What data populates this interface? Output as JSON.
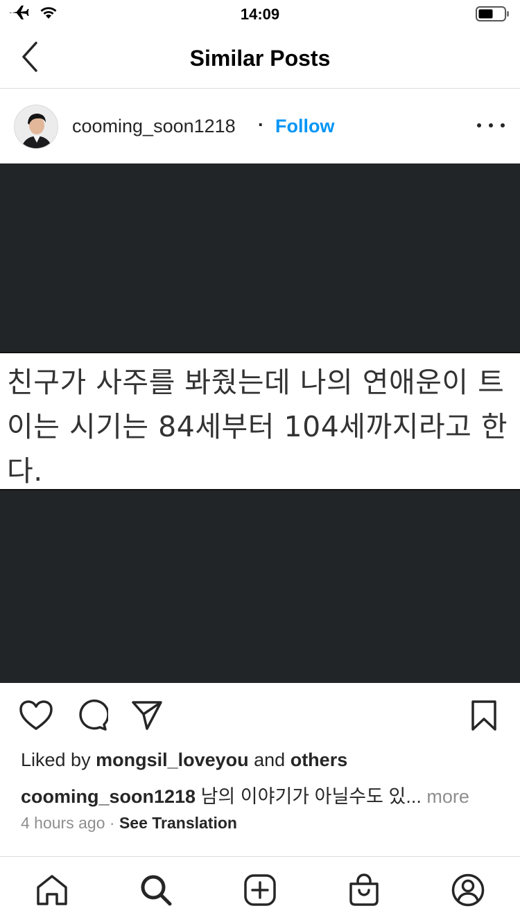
{
  "status_bar": {
    "time": "14:09",
    "icons": [
      "airplane-icon",
      "wifi-icon",
      "battery-icon"
    ]
  },
  "nav": {
    "back_icon": "chevron-left-icon",
    "title": "Similar Posts"
  },
  "post": {
    "username": "cooming_soon1218",
    "separator": "·",
    "follow_label": "Follow",
    "more_icon": "more-horizontal-icon",
    "image_text": "친구가 사주를 봐줬는데 나의 연애운이 트\n이는 시기는 84세부터 104세까지라고 한\n다.",
    "actions": {
      "like_icon": "heart-icon",
      "comment_icon": "comment-icon",
      "share_icon": "send-icon",
      "save_icon": "bookmark-icon"
    },
    "likes": {
      "prefix": "Liked by ",
      "user": "mongsil_loveyou",
      "middle": " and ",
      "others": "others"
    },
    "caption": {
      "user": "cooming_soon1218",
      "text": " 남의 이야기가 아닐수도 있... ",
      "more_label": "more"
    },
    "meta": {
      "time_ago": "4 hours ago",
      "separator": " · ",
      "see_translation": "See Translation"
    }
  },
  "tab_bar": {
    "items": [
      "home-icon",
      "search-icon",
      "new-post-icon",
      "shop-icon",
      "profile-icon"
    ]
  },
  "colors": {
    "link_blue": "#0095f6",
    "media_bg": "#222527",
    "secondary_text": "#8e8e8e",
    "divider": "#dbdbdb"
  }
}
